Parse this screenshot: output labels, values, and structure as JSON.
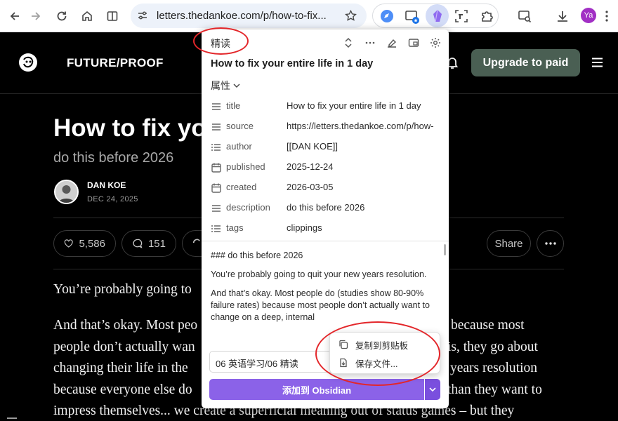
{
  "browser": {
    "url": "letters.thedankoe.com/p/how-to-fix...",
    "avatar_initials": "Ya"
  },
  "site": {
    "name": "FUTURE/PROOF",
    "upgrade_label": "Upgrade to paid"
  },
  "article": {
    "title_visible": "How to fix yo",
    "subtitle": "do this before 2026",
    "author": "DAN KOE",
    "date": "DEC 24, 2025",
    "likes": "5,586",
    "comments": "151",
    "share_label": "Share",
    "body_lines": [
      "You’re probably going to",
      "And that’s okay. Most peo",
      "people don’t actually wan",
      "changing their life in the",
      "because everyone else do",
      "impress themselves... we create a superficial meaning out of status games – but they"
    ],
    "body_right_lines": [
      "because most",
      "is, they go about",
      "years resolution",
      "than they want to"
    ]
  },
  "clipper": {
    "template_label": "精读",
    "page_title": "How to fix your entire life in 1 day",
    "properties_label": "属性",
    "properties": [
      {
        "name": "title",
        "value": "How to fix your entire life in 1 day",
        "icon": "text-lines-icon"
      },
      {
        "name": "source",
        "value": "https://letters.thedankoe.com/p/how-",
        "icon": "text-lines-icon"
      },
      {
        "name": "author",
        "value": "[[DAN KOE]]",
        "icon": "list-icon"
      },
      {
        "name": "published",
        "value": "2025-12-24",
        "icon": "calendar-icon"
      },
      {
        "name": "created",
        "value": "2026-03-05",
        "icon": "calendar-icon"
      },
      {
        "name": "description",
        "value": "do this before 2026",
        "icon": "text-lines-icon"
      },
      {
        "name": "tags",
        "value": "clippings",
        "icon": "list-icon"
      }
    ],
    "preview": {
      "heading": "### do this before 2026",
      "para1": "You’re probably going to quit your new years resolution.",
      "para2": "And that’s okay. Most people do (studies show 80-90% failure rates) because most people don’t actually want to change on a deep, internal"
    },
    "folder": "06 英语学习/06 精读",
    "add_button_label": "添加到 Obsidian",
    "menu": {
      "copy_label": "复制到剪贴板",
      "save_label": "保存文件..."
    }
  }
}
